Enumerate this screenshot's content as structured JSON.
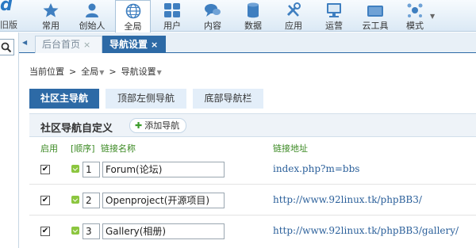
{
  "brand": {
    "logo_mark": "d",
    "old_version": "旧版"
  },
  "nav": [
    {
      "label": "常用",
      "icon": "star-icon"
    },
    {
      "label": "创始人",
      "icon": "person-icon"
    },
    {
      "label": "全局",
      "icon": "globe-icon",
      "active": true
    },
    {
      "label": "用户",
      "icon": "users-icon"
    },
    {
      "label": "内容",
      "icon": "chat-icon"
    },
    {
      "label": "数据",
      "icon": "database-icon"
    },
    {
      "label": "应用",
      "icon": "tools-icon"
    },
    {
      "label": "运营",
      "icon": "monitor-icon"
    },
    {
      "label": "云工具",
      "icon": "cloud-icon"
    },
    {
      "label": "模式",
      "icon": "molecule-icon"
    }
  ],
  "tabs": [
    {
      "label": "后台首页",
      "close": "×"
    },
    {
      "label": "导航设置",
      "close": "×",
      "active": true
    }
  ],
  "breadcrumb": {
    "label": "当前位置",
    "sep": ">",
    "level1": "全局",
    "level2": "导航设置"
  },
  "subtabs": [
    {
      "label": "社区主导航",
      "active": true
    },
    {
      "label": "顶部左侧导航"
    },
    {
      "label": "底部导航栏"
    }
  ],
  "section": {
    "title": "社区导航自定义",
    "add_label": "添加导航",
    "add_icon": "plus-icon"
  },
  "columns": {
    "enabled": "启用",
    "order": "[顺序]",
    "name": "链接名称",
    "url": "链接地址"
  },
  "rows": [
    {
      "enabled": true,
      "order": "1",
      "name": "Forum(论坛)",
      "url": "index.php?m=bbs"
    },
    {
      "enabled": true,
      "order": "2",
      "name": "Openproject(开源项目)",
      "url": "http://www.92linux.tk/phpBB3/"
    },
    {
      "enabled": true,
      "order": "3",
      "name": "Gallery(相册)",
      "url": "http://www.92linux.tk/phpBB3/gallery/"
    }
  ],
  "colors": {
    "accent": "#2d6aa6",
    "link": "#2a5f9a",
    "header_green": "#3c8a24"
  }
}
